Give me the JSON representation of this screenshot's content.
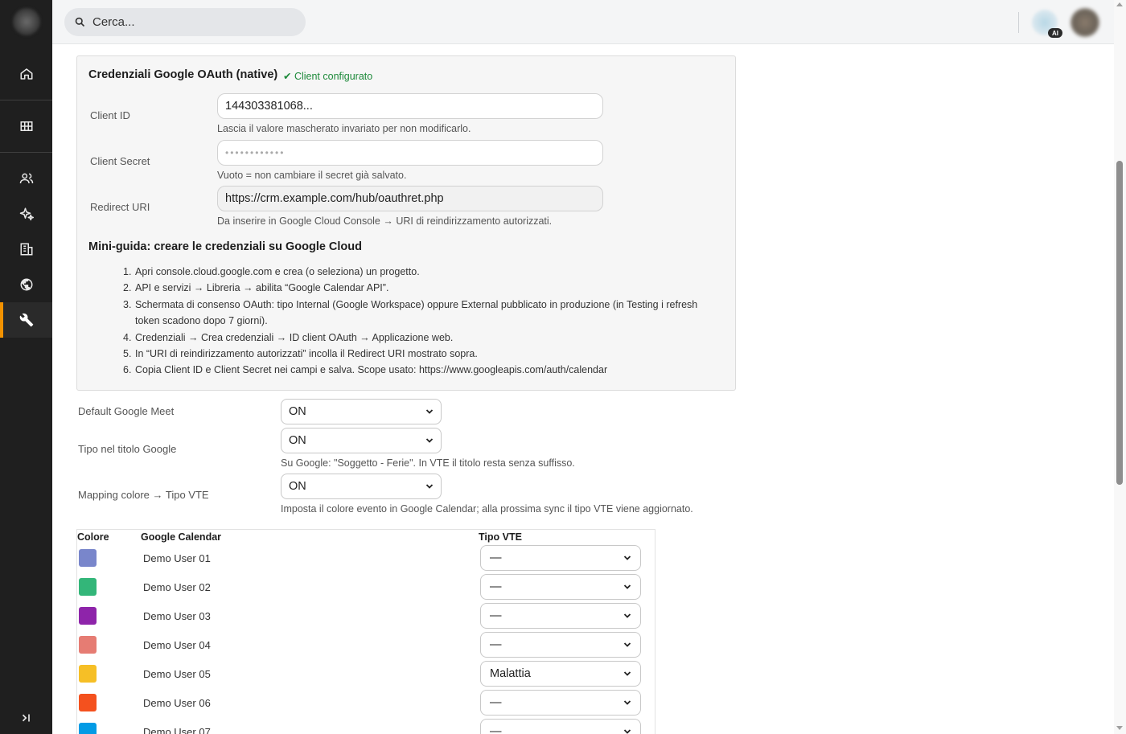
{
  "search": {
    "placeholder": "Cerca..."
  },
  "topbar": {
    "ai_badge": "AI"
  },
  "sidebar": {
    "items": [
      {
        "icon": "home-icon"
      },
      {
        "icon": "grid-icon"
      },
      {
        "icon": "users-icon"
      },
      {
        "icon": "sparkles-icon"
      },
      {
        "icon": "building-icon"
      },
      {
        "icon": "globe-icon"
      },
      {
        "icon": "wrench-icon",
        "active": true
      }
    ],
    "collapse_icon": "collapse-icon",
    "accent_color": "#f39200"
  },
  "oauth": {
    "title": "Credenziali Google OAuth (native)",
    "status": "✔ Client configurato",
    "client_id": {
      "label": "Client ID",
      "value": "144303381068...",
      "hint": "Lascia il valore mascherato invariato per non modificarlo."
    },
    "client_secret": {
      "label": "Client Secret",
      "value": "••••••••••••",
      "hint": "Vuoto = non cambiare il secret già salvato."
    },
    "redirect_uri": {
      "label": "Redirect URI",
      "value": "https://crm.example.com/hub/oauthret.php",
      "hint": "Da inserire in Google Cloud Console → URI di reindirizzamento autorizzati."
    },
    "guide_title": "Mini-guida: creare le credenziali su Google Cloud",
    "guide_steps": [
      "Apri console.cloud.google.com e crea (o seleziona) un progetto.",
      "API e servizi → Libreria → abilita “Google Calendar API”.",
      "Schermata di consenso OAuth: tipo Internal (Google Workspace) oppure External pubblicato in produzione (in Testing i refresh token scadono dopo 7 giorni).",
      "Credenziali → Crea credenziali → ID client OAuth → Applicazione web.",
      "In “URI di reindirizzamento autorizzati” incolla il Redirect URI mostrato sopra.",
      "Copia Client ID e Client Secret nei campi e salva. Scope usato: https://www.googleapis.com/auth/calendar"
    ],
    "guide_numbers": [
      "1.",
      "2.",
      "3.",
      "4.",
      "5.",
      "6."
    ]
  },
  "settings": {
    "default_meet": {
      "label": "Default Google Meet",
      "value": "ON"
    },
    "tipo_titolo": {
      "label": "Tipo nel titolo Google",
      "value": "ON",
      "hint": "Su Google: \"Soggetto - Ferie\". In VTE il titolo resta senza suffisso."
    },
    "mapping_colore": {
      "label": "Mapping colore → Tipo VTE",
      "value": "ON",
      "hint": "Imposta il colore evento in Google Calendar; alla prossima sync il tipo VTE viene aggiornato."
    }
  },
  "mapping_table": {
    "headers": {
      "color": "Colore",
      "calendar": "Google Calendar",
      "type": "Tipo VTE"
    },
    "rows": [
      {
        "color": "#7986cb",
        "calendar": "Demo User 01",
        "type": "—"
      },
      {
        "color": "#33b679",
        "calendar": "Demo User 02",
        "type": "—"
      },
      {
        "color": "#8e24aa",
        "calendar": "Demo User 03",
        "type": "—"
      },
      {
        "color": "#e67c73",
        "calendar": "Demo User 04",
        "type": "—"
      },
      {
        "color": "#f6bf26",
        "calendar": "Demo User 05",
        "type": "Malattia"
      },
      {
        "color": "#f4511e",
        "calendar": "Demo User 06",
        "type": "—"
      },
      {
        "color": "#039be5",
        "calendar": "Demo User 07",
        "type": "—"
      }
    ]
  }
}
